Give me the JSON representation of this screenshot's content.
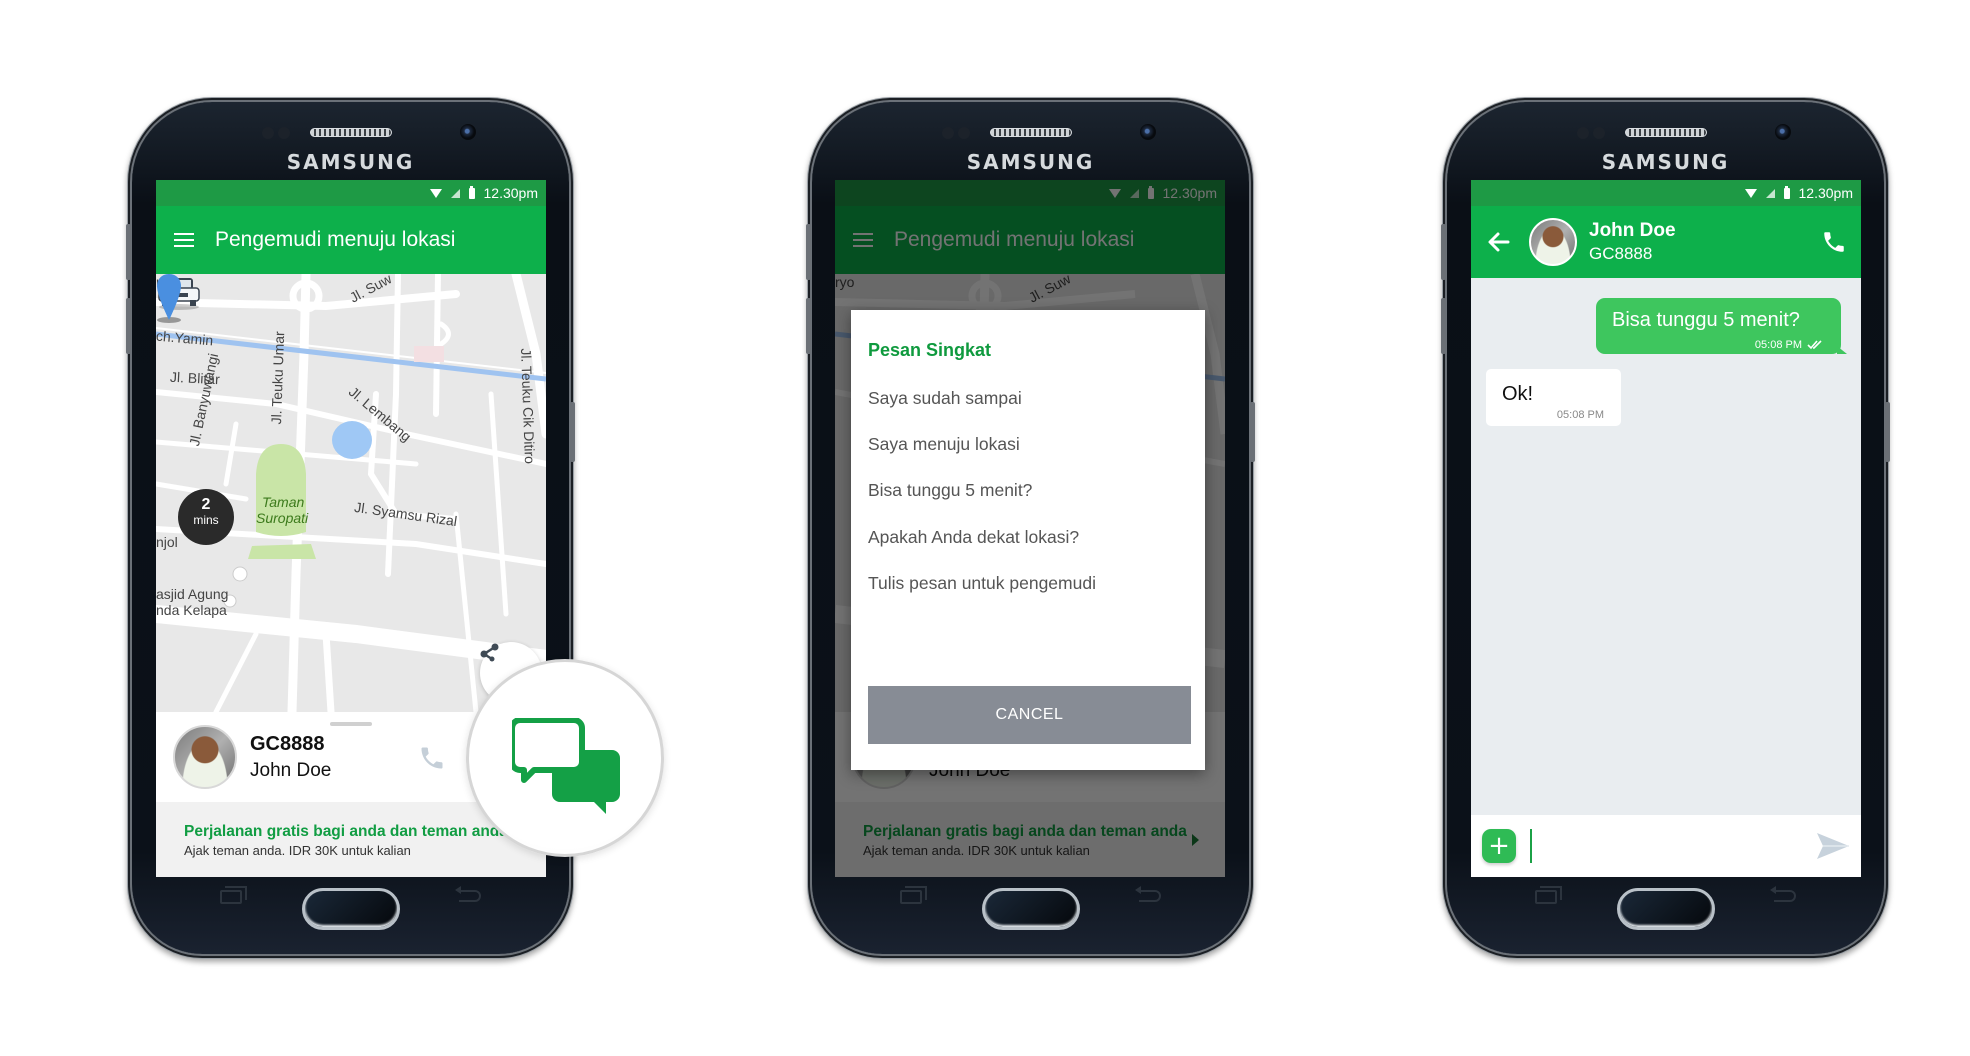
{
  "device": {
    "brand": "SAMSUNG"
  },
  "status_bar": {
    "time": "12.30pm",
    "icons": [
      "wifi-icon",
      "signal-icon",
      "battery-icon"
    ]
  },
  "colors": {
    "primary_green": "#0db04b",
    "status_green": "#1e9a45",
    "bubble_green": "#3ec65e",
    "promo_green": "#119d43",
    "cancel_grey": "#878c95",
    "chat_bg": "#e9edf0"
  },
  "screen1": {
    "title": "Pengemudi menuju lokasi",
    "map": {
      "labels": [
        "ryo",
        "Jl. Suw",
        "ch.Yamin",
        "Jl. Blitar",
        "Jl. Banyuwangi",
        "Jl. Teuku Umar",
        "Jl. Lembang",
        "Jl. Teuku Cik Ditiro",
        "Taman",
        "Suropati",
        "Jl. Syamsu Rizal",
        "njol",
        "asjid Agung",
        "nda Kelapa"
      ],
      "eta": {
        "value": "2",
        "unit": "mins"
      }
    },
    "driver": {
      "plate": "GC8888",
      "name": "John Doe"
    },
    "promo": {
      "title": "Perjalanan gratis bagi anda dan teman anda",
      "subtitle": "Ajak teman anda. IDR 30K untuk kalian"
    }
  },
  "screen2": {
    "title": "Pengemudi menuju lokasi",
    "dialog": {
      "title": "Pesan Singkat",
      "options": [
        "Saya sudah sampai",
        "Saya menuju lokasi",
        "Bisa tunggu 5 menit?",
        "Apakah Anda dekat lokasi?",
        "Tulis pesan untuk pengemudi"
      ],
      "cancel_label": "CANCEL"
    },
    "driver": {
      "name": "John Doe"
    },
    "promo": {
      "title": "Perjalanan gratis bagi anda dan teman anda",
      "subtitle": "Ajak teman anda. IDR 30K untuk kalian"
    }
  },
  "screen3": {
    "contact": {
      "name": "John Doe",
      "plate": "GC8888"
    },
    "messages": [
      {
        "direction": "outgoing",
        "text": "Bisa tunggu 5 menit?",
        "time": "05:08 PM",
        "status": "read"
      },
      {
        "direction": "incoming",
        "text": "Ok!",
        "time": "05:08 PM"
      }
    ],
    "composer": {
      "value": "",
      "placeholder": ""
    }
  }
}
